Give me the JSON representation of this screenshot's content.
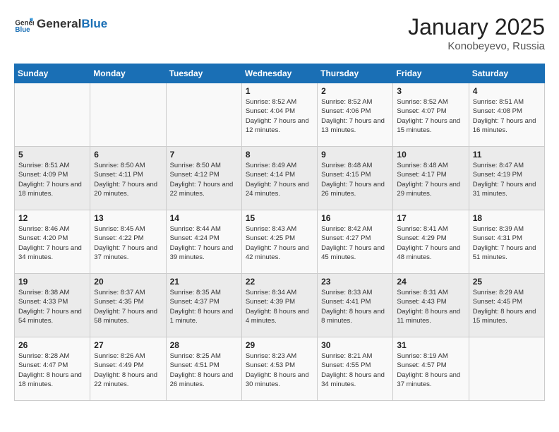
{
  "header": {
    "logo": {
      "general": "General",
      "blue": "Blue"
    },
    "title": "January 2025",
    "subtitle": "Konobeyevo, Russia"
  },
  "weekdays": [
    "Sunday",
    "Monday",
    "Tuesday",
    "Wednesday",
    "Thursday",
    "Friday",
    "Saturday"
  ],
  "weeks": [
    [
      {
        "day": "",
        "sunrise": "",
        "sunset": "",
        "daylight": ""
      },
      {
        "day": "",
        "sunrise": "",
        "sunset": "",
        "daylight": ""
      },
      {
        "day": "",
        "sunrise": "",
        "sunset": "",
        "daylight": ""
      },
      {
        "day": "1",
        "sunrise": "Sunrise: 8:52 AM",
        "sunset": "Sunset: 4:04 PM",
        "daylight": "Daylight: 7 hours and 12 minutes."
      },
      {
        "day": "2",
        "sunrise": "Sunrise: 8:52 AM",
        "sunset": "Sunset: 4:06 PM",
        "daylight": "Daylight: 7 hours and 13 minutes."
      },
      {
        "day": "3",
        "sunrise": "Sunrise: 8:52 AM",
        "sunset": "Sunset: 4:07 PM",
        "daylight": "Daylight: 7 hours and 15 minutes."
      },
      {
        "day": "4",
        "sunrise": "Sunrise: 8:51 AM",
        "sunset": "Sunset: 4:08 PM",
        "daylight": "Daylight: 7 hours and 16 minutes."
      }
    ],
    [
      {
        "day": "5",
        "sunrise": "Sunrise: 8:51 AM",
        "sunset": "Sunset: 4:09 PM",
        "daylight": "Daylight: 7 hours and 18 minutes."
      },
      {
        "day": "6",
        "sunrise": "Sunrise: 8:50 AM",
        "sunset": "Sunset: 4:11 PM",
        "daylight": "Daylight: 7 hours and 20 minutes."
      },
      {
        "day": "7",
        "sunrise": "Sunrise: 8:50 AM",
        "sunset": "Sunset: 4:12 PM",
        "daylight": "Daylight: 7 hours and 22 minutes."
      },
      {
        "day": "8",
        "sunrise": "Sunrise: 8:49 AM",
        "sunset": "Sunset: 4:14 PM",
        "daylight": "Daylight: 7 hours and 24 minutes."
      },
      {
        "day": "9",
        "sunrise": "Sunrise: 8:48 AM",
        "sunset": "Sunset: 4:15 PM",
        "daylight": "Daylight: 7 hours and 26 minutes."
      },
      {
        "day": "10",
        "sunrise": "Sunrise: 8:48 AM",
        "sunset": "Sunset: 4:17 PM",
        "daylight": "Daylight: 7 hours and 29 minutes."
      },
      {
        "day": "11",
        "sunrise": "Sunrise: 8:47 AM",
        "sunset": "Sunset: 4:19 PM",
        "daylight": "Daylight: 7 hours and 31 minutes."
      }
    ],
    [
      {
        "day": "12",
        "sunrise": "Sunrise: 8:46 AM",
        "sunset": "Sunset: 4:20 PM",
        "daylight": "Daylight: 7 hours and 34 minutes."
      },
      {
        "day": "13",
        "sunrise": "Sunrise: 8:45 AM",
        "sunset": "Sunset: 4:22 PM",
        "daylight": "Daylight: 7 hours and 37 minutes."
      },
      {
        "day": "14",
        "sunrise": "Sunrise: 8:44 AM",
        "sunset": "Sunset: 4:24 PM",
        "daylight": "Daylight: 7 hours and 39 minutes."
      },
      {
        "day": "15",
        "sunrise": "Sunrise: 8:43 AM",
        "sunset": "Sunset: 4:25 PM",
        "daylight": "Daylight: 7 hours and 42 minutes."
      },
      {
        "day": "16",
        "sunrise": "Sunrise: 8:42 AM",
        "sunset": "Sunset: 4:27 PM",
        "daylight": "Daylight: 7 hours and 45 minutes."
      },
      {
        "day": "17",
        "sunrise": "Sunrise: 8:41 AM",
        "sunset": "Sunset: 4:29 PM",
        "daylight": "Daylight: 7 hours and 48 minutes."
      },
      {
        "day": "18",
        "sunrise": "Sunrise: 8:39 AM",
        "sunset": "Sunset: 4:31 PM",
        "daylight": "Daylight: 7 hours and 51 minutes."
      }
    ],
    [
      {
        "day": "19",
        "sunrise": "Sunrise: 8:38 AM",
        "sunset": "Sunset: 4:33 PM",
        "daylight": "Daylight: 7 hours and 54 minutes."
      },
      {
        "day": "20",
        "sunrise": "Sunrise: 8:37 AM",
        "sunset": "Sunset: 4:35 PM",
        "daylight": "Daylight: 7 hours and 58 minutes."
      },
      {
        "day": "21",
        "sunrise": "Sunrise: 8:35 AM",
        "sunset": "Sunset: 4:37 PM",
        "daylight": "Daylight: 8 hours and 1 minute."
      },
      {
        "day": "22",
        "sunrise": "Sunrise: 8:34 AM",
        "sunset": "Sunset: 4:39 PM",
        "daylight": "Daylight: 8 hours and 4 minutes."
      },
      {
        "day": "23",
        "sunrise": "Sunrise: 8:33 AM",
        "sunset": "Sunset: 4:41 PM",
        "daylight": "Daylight: 8 hours and 8 minutes."
      },
      {
        "day": "24",
        "sunrise": "Sunrise: 8:31 AM",
        "sunset": "Sunset: 4:43 PM",
        "daylight": "Daylight: 8 hours and 11 minutes."
      },
      {
        "day": "25",
        "sunrise": "Sunrise: 8:29 AM",
        "sunset": "Sunset: 4:45 PM",
        "daylight": "Daylight: 8 hours and 15 minutes."
      }
    ],
    [
      {
        "day": "26",
        "sunrise": "Sunrise: 8:28 AM",
        "sunset": "Sunset: 4:47 PM",
        "daylight": "Daylight: 8 hours and 18 minutes."
      },
      {
        "day": "27",
        "sunrise": "Sunrise: 8:26 AM",
        "sunset": "Sunset: 4:49 PM",
        "daylight": "Daylight: 8 hours and 22 minutes."
      },
      {
        "day": "28",
        "sunrise": "Sunrise: 8:25 AM",
        "sunset": "Sunset: 4:51 PM",
        "daylight": "Daylight: 8 hours and 26 minutes."
      },
      {
        "day": "29",
        "sunrise": "Sunrise: 8:23 AM",
        "sunset": "Sunset: 4:53 PM",
        "daylight": "Daylight: 8 hours and 30 minutes."
      },
      {
        "day": "30",
        "sunrise": "Sunrise: 8:21 AM",
        "sunset": "Sunset: 4:55 PM",
        "daylight": "Daylight: 8 hours and 34 minutes."
      },
      {
        "day": "31",
        "sunrise": "Sunrise: 8:19 AM",
        "sunset": "Sunset: 4:57 PM",
        "daylight": "Daylight: 8 hours and 37 minutes."
      },
      {
        "day": "",
        "sunrise": "",
        "sunset": "",
        "daylight": ""
      }
    ]
  ]
}
